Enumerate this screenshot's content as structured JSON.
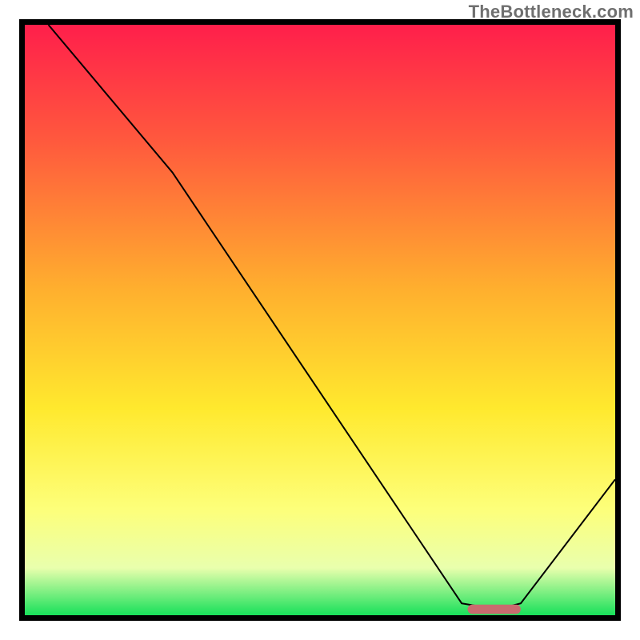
{
  "watermark": "TheBottleneck.com",
  "chart_data": {
    "type": "line",
    "title": "",
    "xlabel": "",
    "ylabel": "",
    "xlim": [
      0,
      100
    ],
    "ylim": [
      0,
      100
    ],
    "curve": {
      "name": "bottleneck-curve",
      "x": [
        4,
        25,
        74,
        80,
        84,
        100
      ],
      "y": [
        100,
        75,
        2,
        1,
        2,
        23
      ]
    },
    "marker": {
      "name": "target-range-marker",
      "x_start": 75,
      "x_end": 84,
      "y": 1,
      "color": "#c96b6f"
    },
    "gradient_stops": [
      {
        "pct": 0,
        "color": "#ff1f4b"
      },
      {
        "pct": 20,
        "color": "#ff5a3d"
      },
      {
        "pct": 45,
        "color": "#ffb02e"
      },
      {
        "pct": 65,
        "color": "#ffe92e"
      },
      {
        "pct": 82,
        "color": "#fdff7a"
      },
      {
        "pct": 92,
        "color": "#e9ffad"
      },
      {
        "pct": 100,
        "color": "#18e05a"
      }
    ]
  }
}
